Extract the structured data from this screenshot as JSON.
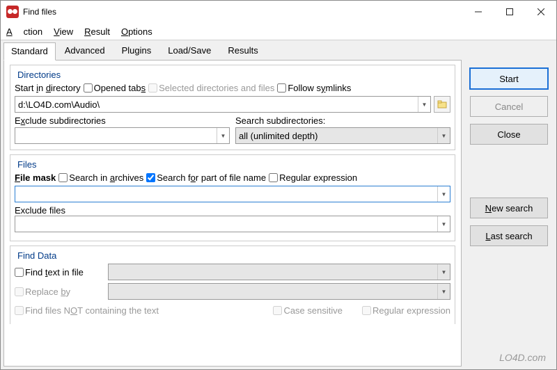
{
  "title": "Find files",
  "menus": {
    "action": "Action",
    "view": "View",
    "result": "Result",
    "options": "Options"
  },
  "tabs": {
    "standard": "Standard",
    "advanced": "Advanced",
    "plugins": "Plugins",
    "loadsave": "Load/Save",
    "results": "Results"
  },
  "directories": {
    "legend": "Directories",
    "start_label": "Start in directory",
    "opened_tabs": "Opened tabs",
    "selected_dirs": "Selected directories and files",
    "follow_symlinks": "Follow symlinks",
    "path_value": "d:\\LO4D.com\\Audio\\",
    "exclude_label": "Exclude subdirectories",
    "search_sub_label": "Search subdirectories:",
    "search_sub_value": "all (unlimited depth)"
  },
  "files": {
    "legend": "Files",
    "file_mask": "File mask",
    "search_archives": "Search in archives",
    "search_part": "Search for part of file name",
    "regex": "Regular expression",
    "mask_value": "",
    "exclude_files_label": "Exclude files"
  },
  "finddata": {
    "legend": "Find Data",
    "find_text": "Find text in file",
    "replace_by": "Replace by",
    "not_containing": "Find files NOT containing the text",
    "case_sensitive": "Case sensitive",
    "regex2": "Regular expression"
  },
  "buttons": {
    "start": "Start",
    "cancel": "Cancel",
    "close": "Close",
    "new_search": "New search",
    "last_search": "Last search"
  },
  "watermark": "LO4D.com"
}
